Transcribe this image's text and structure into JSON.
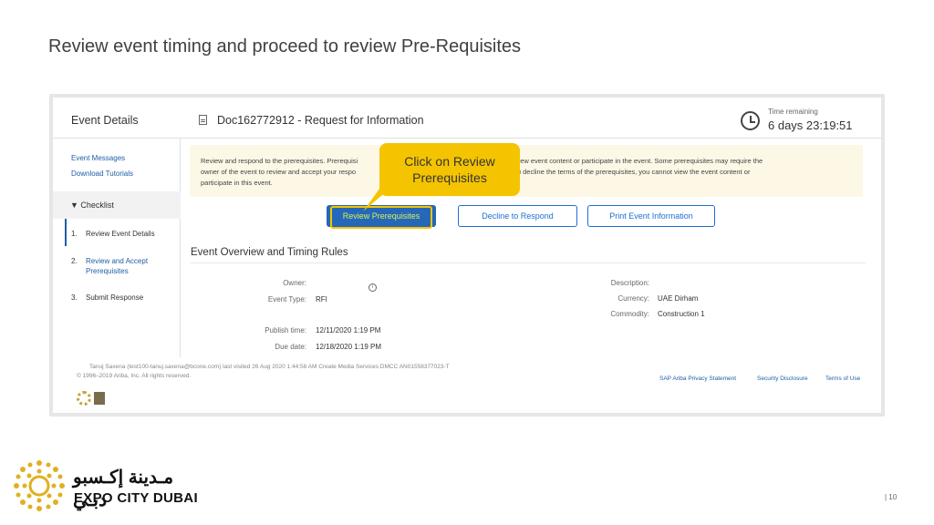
{
  "slide": {
    "title": "Review event timing and proceed to review Pre-Requisites",
    "page_number": "| 10"
  },
  "header": {
    "event_details": "Event Details",
    "doc_title": "Doc162772912 - Request for Information",
    "time_remaining_label": "Time remaining",
    "time_remaining_value": "6 days 23:19:51"
  },
  "sidebar": {
    "links": [
      "Event Messages",
      "Download Tutorials"
    ],
    "checklist_header": "▼ Checklist",
    "checklist": [
      {
        "num": "1.",
        "label": "Review Event Details"
      },
      {
        "num": "2.",
        "label": "Review and Accept Prerequisites"
      },
      {
        "num": "3.",
        "label": "Submit Response"
      }
    ]
  },
  "banner": {
    "text_left": "Review and respond to the prerequisites. Prerequisi",
    "text_right": "ou can view event content or participate in the event. Some prerequisites may require the",
    "line2_left": "owner of the event to review and accept your respo",
    "line2_right": "ent. If you decline the terms of the prerequisites, you cannot view the event content or",
    "line3": "participate in this event."
  },
  "buttons": {
    "review": "Review Prerequisites",
    "decline": "Decline to Respond",
    "print": "Print Event Information"
  },
  "overview": {
    "title": "Event Overview and Timing Rules",
    "owner_label": "Owner:",
    "event_type_label": "Event Type:",
    "event_type_value": "RFI",
    "publish_label": "Publish time:",
    "publish_value": "12/11/2020 1:19 PM",
    "due_label": "Due date:",
    "due_value": "12/18/2020 1:19 PM",
    "description_label": "Description:",
    "currency_label": "Currency:",
    "currency_value": "UAE Dirham",
    "commodity_label": "Commodity:",
    "commodity_value": "Construction 1"
  },
  "footer": {
    "visit_line": "Tanuj Saxena (test100-tanuj.saxena@bcone.com) last visited 26 Aug 2020 1:44:58 AM   Create Media Services DMCC  AN01558377023-T",
    "copyright": "© 1996–2019 Ariba, Inc. All rights reserved.",
    "privacy": "SAP Ariba Privacy Statement",
    "security": "Security Disclosure",
    "terms": "Terms of Use"
  },
  "callout": {
    "line1": "Click on Review",
    "line2": "Prerequisites"
  },
  "branding": {
    "arabic": "مـدينة إكـسبو دبـي",
    "english": "EXPO CITY DUBAI"
  },
  "colors": {
    "accent_blue": "#2567b8",
    "callout_yellow": "#f5c400",
    "logo_gold": "#e0b020"
  }
}
